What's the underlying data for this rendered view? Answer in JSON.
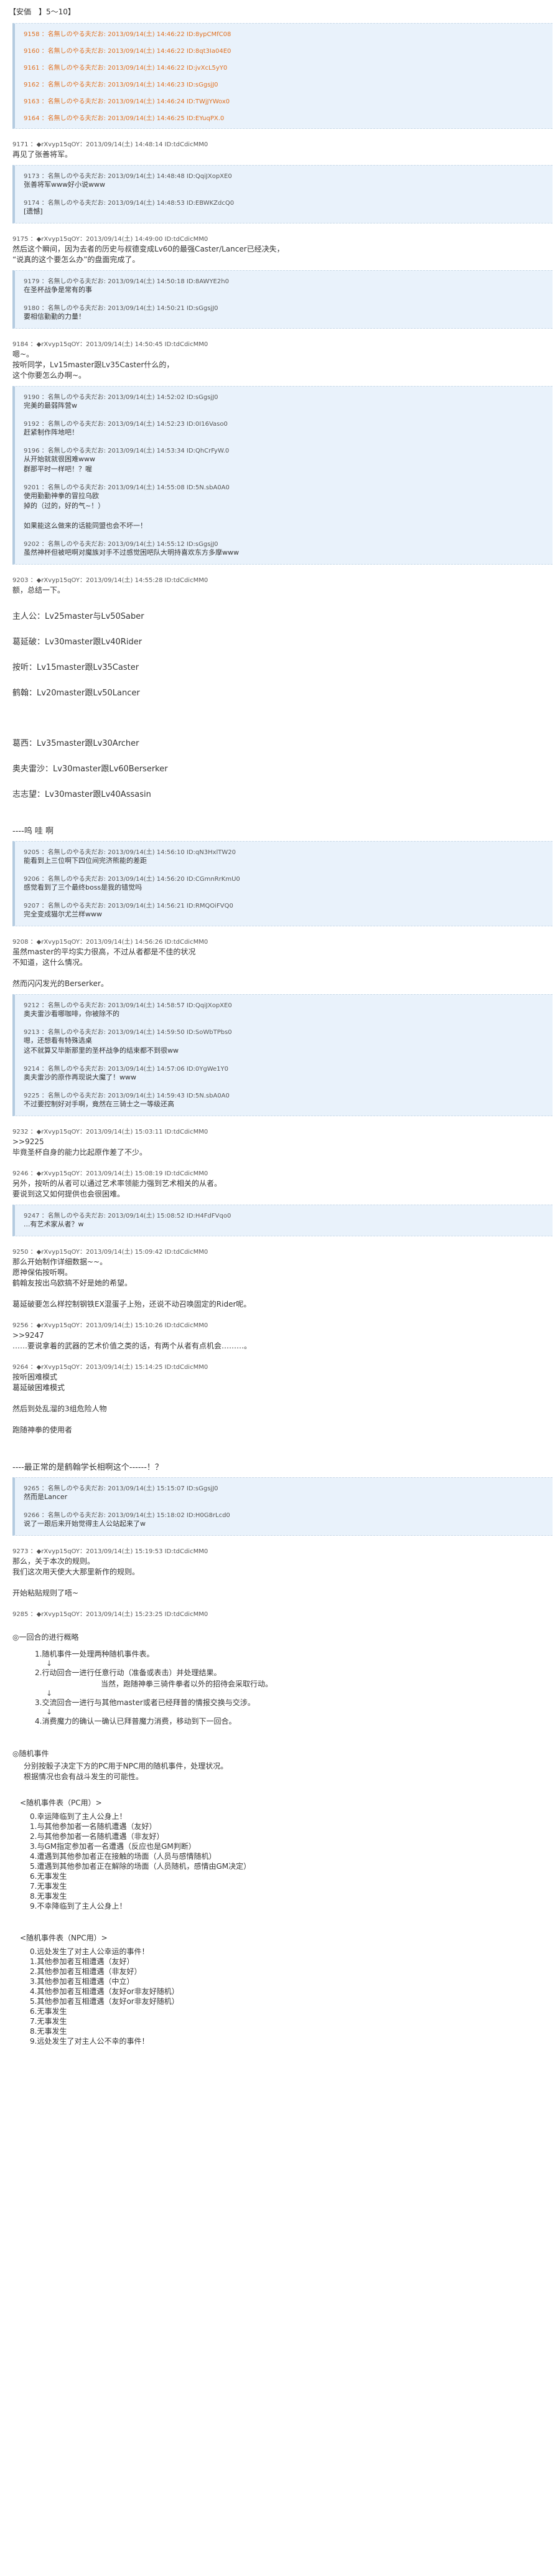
{
  "title": "【安価　】5～10】",
  "quote1": [
    {
      "h": "9158 ：名無しのやる夫だお: 2013/09/14(土) 14:46:22 ID:8ypCMfC08",
      "b": ""
    },
    {
      "h": "9160 ：名無しのやる夫だお: 2013/09/14(土) 14:46:22 ID:8qt3Ia04E0",
      "b": ""
    },
    {
      "h": "9161 ：名無しのやる夫だお: 2013/09/14(土) 14:46:22 ID:jvXcL5yY0",
      "b": ""
    },
    {
      "h": "9162 ：名無しのやる夫だお: 2013/09/14(土) 14:46:23 ID:sGgsjJ0",
      "b": ""
    },
    {
      "h": "9163 ：名無しのやる夫だお: 2013/09/14(土) 14:46:24 ID:TWjJYWox0",
      "b": ""
    },
    {
      "h": "9164 ：名無しのやる夫だお: 2013/09/14(土) 14:46:25 ID:EYuqPX.0",
      "b": ""
    }
  ],
  "post9171": {
    "h": "9171 ：◆rXvyp15qOY：2013/09/14(土) 14:48:14 ID:tdCdicMM0",
    "b": "再见了张善将军。"
  },
  "quote2": [
    {
      "h": "9173 ：名無しのやる夫だお: 2013/09/14(土) 14:48:48 ID:QqiJXopXE0",
      "b": "张善将军www好小说www"
    },
    {
      "h": "9174 ：名無しのやる夫だお: 2013/09/14(土) 14:48:53 ID:EBWKZdcQ0",
      "b": "[遗憾]"
    }
  ],
  "post9175": {
    "h": "9175 ：◆rXvyp15qOY：2013/09/14(土) 14:49:00 ID:tdCdicMM0",
    "b": "然后这个瞬间，因为去者的历史与叔德变成Lv60的最强Caster/Lancer已经决失，\n“说真的这个要怎么办”的盘面完成了。"
  },
  "quote3": [
    {
      "h": "9179 ：名無しのやる夫だお: 2013/09/14(土) 14:50:18 ID:8AWYE2h0",
      "b": "在圣杯战争是常有的事"
    },
    {
      "h": "9180 ：名無しのやる夫だお: 2013/09/14(土) 14:50:21 ID:sGgsjJ0",
      "b": "要相信勤勤的力量！"
    }
  ],
  "post9184": {
    "h": "9184 ：◆rXvyp15qOY：2013/09/14(土) 14:50:45 ID:tdCdicMM0",
    "b": "嗯~。\n按听同学，Lv15master跟Lv35Caster什么的，\n这个你要怎么办啊~。"
  },
  "quote4": [
    {
      "h": "9190 ：名無しのやる夫だお: 2013/09/14(土) 14:52:02 ID:sGgsjJ0",
      "b": "完美的最弱阵营w"
    },
    {
      "h": "9192 ：名無しのやる夫だお: 2013/09/14(土) 14:52:23 ID:0I16Vaso0",
      "b": "赶紧制作阵地吧！"
    },
    {
      "h": "9196 ：名無しのやる夫だお: 2013/09/14(土) 14:53:34 ID:QhCrFyW.0",
      "b": "从开始就就很困难www\n群那平时一样吧！？喔"
    },
    {
      "h": "9201 ：名無しのやる夫だお: 2013/09/14(土) 14:55:08 ID:5N.sbA0A0",
      "b": "使用勤勤神拳的冒拉乌欧\n掉的（过的，好的气~！）\n\n如果能这么做来的话能同盟也会不坏一！"
    },
    {
      "h": "9202 ：名無しのやる夫だお: 2013/09/14(土) 14:55:12 ID:sGgsjJ0",
      "b": "虽然神杯但被吧啊对魔族对手不过感觉困吧队大明持喜欢东方多摩www"
    }
  ],
  "post9203": {
    "h": "9203 ：◆rXvyp15qOY：2013/09/14(土) 14:55:28 ID:tdCdicMM0",
    "b": "额，总结一下。"
  },
  "roster1": [
    "主人公：Lv25master与Lv50Saber",
    "葛延破：Lv30master跟Lv40Rider",
    "按听：Lv15master跟Lv35Caster",
    "鹤翰：Lv20master跟Lv50Lancer"
  ],
  "roster2": [
    "葛西：Lv35master跟Lv30Archer",
    "奥夫雷沙：Lv30master跟Lv60Berserker",
    "志志望：Lv30master跟Lv40Assasin"
  ],
  "ohwow": "----呜 哇 啊",
  "quote5": [
    {
      "h": "9205 ：名無しのやる夫だお: 2013/09/14(土) 14:56:10 ID:qN3HxlTW20",
      "b": "能看到上三位啊下四位间完济熊能的差距"
    },
    {
      "h": "9206 ：名無しのやる夫だお: 2013/09/14(土) 14:56:20 ID:CGmnRrKmU0",
      "b": "感觉看到了三个最终boss是我的错觉吗"
    },
    {
      "h": "9207 ：名無しのやる夫だお: 2013/09/14(土) 14:56:21 ID:RMQOiFVQ0",
      "b": "完全变成猫尔尤兰样www"
    }
  ],
  "post9208": {
    "h": "9208 ：◆rXvyp15qOY：2013/09/14(土) 14:56:26 ID:tdCdicMM0",
    "b": "虽然master的平均实力很高，不过从者都是不佳的状况\n不知道，这什么情况。\n\n然而闪闪发光的Berserker。"
  },
  "quote6": [
    {
      "h": "9212 ：名無しのやる夫だお: 2013/09/14(土) 14:58:57 ID:QqiJXopXE0",
      "b": "奥夫雷沙看哪咖啡，你被除不的"
    },
    {
      "h": "9213 ：名無しのやる夫だお: 2013/09/14(土) 14:59:50 ID:SoWbTPbs0",
      "b": "嗯，还想看有特殊选桌\n这不就算又毕斯那里的圣杯战争的结束都不到很ww"
    },
    {
      "h": "9214 ：名無しのやる夫だお: 2013/09/14(土) 14:57:06 ID:0YgWe1Y0",
      "b": "奥夫雷沙的原作再现说大魔了！www"
    },
    {
      "h": "9225 ：名無しのやる夫だお: 2013/09/14(土) 14:59:43 ID:5N.sbA0A0",
      "b": "不过要控制好对手啊，竟然在三骑士之一等级还高"
    }
  ],
  "post9232": {
    "h": "9232 ：◆rXvyp15qOY：2013/09/14(土) 15:03:11 ID:tdCdicMM0",
    "b": ">>9225\n毕竟圣杯自身的能力比起原作差了不少。"
  },
  "post9246": {
    "h": "9246 ：◆rXvyp15qOY：2013/09/14(土) 15:08:19 ID:tdCdicMM0",
    "b": "另外，按听的从者可以通过艺术率领能力强到艺术相关的从者。\n要说到这又如何提供也会很困难。"
  },
  "quote7": [
    {
      "h": "9247 ：名無しのやる夫だお: 2013/09/14(土) 15:08:52 ID:H4FdFVqo0",
      "b": "...有艺术家从者？w"
    }
  ],
  "post9250": {
    "h": "9250 ：◆rXvyp15qOY：2013/09/14(土) 15:09:42 ID:tdCdicMM0",
    "b": "那么开始制作详细数据~~。\n愿神保佑按听啊。\n鹤翰友按出乌欧搞不好是她的希望。\n\n葛延破要怎么样控制钢铁EX混蛋子上殆，还说不动召唤固定的Rider呢。"
  },
  "post9256": {
    "h": "9256 ：◆rXvyp15qOY：2013/09/14(土) 15:10:26 ID:tdCdicMM0",
    "b": ">>9247\n……要说拿着的武器的艺术价值之类的话，有两个从者有点机会………。"
  },
  "post9264": {
    "h": "9264 ：◆rXvyp15qOY：2013/09/14(土) 15:14:25 ID:tdCdicMM0",
    "b": "按听困难模式\n葛延破困难模式\n\n然后到处乱溜的3组危险人物\n\n跑随神拳的使用者"
  },
  "strongest": "----最正常的是鹤翰学长相啊这个------！？",
  "quote8": [
    {
      "h": "9265 ：名無しのやる夫だお: 2013/09/14(土) 15:15:07 ID:sGgsjJ0",
      "b": "然而是Lancer"
    },
    {
      "h": "9266 ：名無しのやる夫だお: 2013/09/14(土) 15:18:02 ID:H0G8rLcd0",
      "b": "说了一跟后来开始觉得主人公站起来了w"
    }
  ],
  "post9273": {
    "h": "9273 ：◆rXvyp15qOY：2013/09/14(土) 15:19:53 ID:tdCdicMM0",
    "b": "那么，关于本次的规则。\n我们这次用天使大大那里新作的规则。\n\n开始粘贴规则了唔~"
  },
  "post9285": {
    "h": "9285 ：◆rXvyp15qOY：2013/09/14(土) 15:23:25 ID:tdCdicMM0",
    "b": ""
  },
  "rules": {
    "head": "◎一回合的进行概略",
    "steps": [
      "1.随机事件一处理两种随机事件表。",
      "2.行动回合一进行任意行动（准备或表击）并处理结果。",
      "3.交流回合一进行与其他master或者已经拜普的情报交换与交涉。",
      "4.消费魔力的确认一确认已拜普魔力消费，移动到下一回合。"
    ],
    "step2note": "当然，跑随神拳三骑件拳者以外的招待会采取行动。",
    "arrow": "↓",
    "random_head": "◎随机事件",
    "random_desc": "分别按骰子决定下方的PC用于NPC用的随机事件，处理状况。\n根据情况也会有战斗发生的可能性。",
    "pc_head": "<随机事件表（PC用）>",
    "pc_items": [
      "0.幸运降临到了主人公身上！",
      "1.与其他参加者一名随机遭遇（友好）",
      "2.与其他参加者一名随机遭遇（非友好）",
      "3.与GM指定参加者一名遭遇（反应也是GM判断）",
      "4.遭遇到其他参加者正在接触的场面（人员与感情随机）",
      "5.遭遇到其他参加者正在解除的场面（人员随机，感情由GM决定）",
      "6.无事发生",
      "7.无事发生",
      "8.无事发生",
      "9.不幸降临到了主人公身上！"
    ],
    "npc_head": "<随机事件表（NPC用）>",
    "npc_items": [
      "0.远处发生了对主人公幸运的事件！",
      "1.其他参加者互相遭遇（友好）",
      "2.其他参加者互相遭遇（非友好）",
      "3.其他参加者互相遭遇（中立）",
      "4.其他参加者互相遭遇（友好or非友好随机）",
      "5.其他参加者互相遭遇（友好or非友好随机）",
      "6.无事发生",
      "7.无事发生",
      "8.无事发生",
      "9.远处发生了对主人公不幸的事件！"
    ]
  }
}
